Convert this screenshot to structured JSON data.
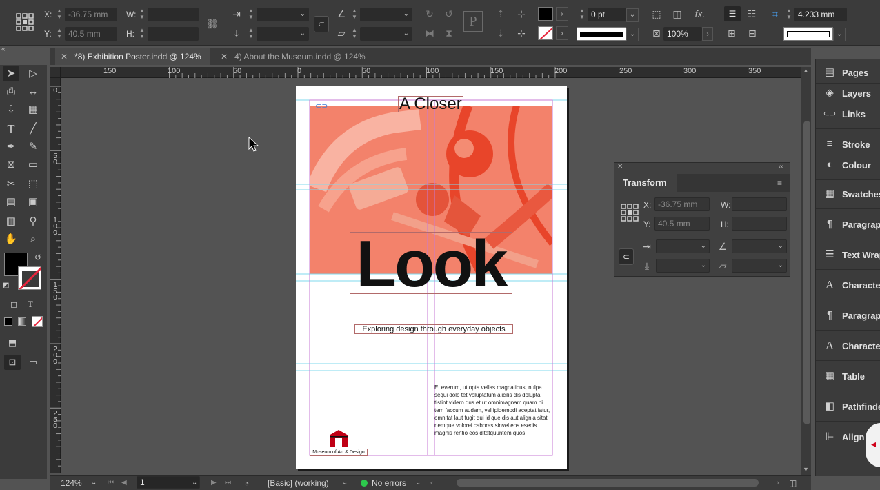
{
  "control_panel": {
    "x_label": "X:",
    "x_value": "-36.75 mm",
    "y_label": "Y:",
    "y_value": "40.5 mm",
    "w_label": "W:",
    "h_label": "H:",
    "stroke_weight": "0 pt",
    "opacity": "100%",
    "gutter_value": "4.233 mm",
    "fx_label": "fx."
  },
  "tabs": [
    {
      "label": "*8) Exhibition Poster.indd @ 124%",
      "active": true
    },
    {
      "label": "4) About the Museum.indd @ 124%",
      "active": false
    }
  ],
  "ruler": {
    "horizontal": [
      "150",
      "100",
      "50",
      "0",
      "50",
      "100",
      "150",
      "200",
      "250",
      "300",
      "350"
    ],
    "vertical": [
      [
        "0"
      ],
      [
        "5",
        "0"
      ],
      [
        "1",
        "0",
        "0"
      ],
      [
        "1",
        "5",
        "0"
      ],
      [
        "2",
        "0",
        "0"
      ],
      [
        "2",
        "5",
        "0"
      ]
    ]
  },
  "document": {
    "heading_small": "A Closer",
    "heading_large": "Look",
    "subtitle": "Exploring design through everyday objects",
    "body_text": "Et everum, ut opta vellas magnatibus, nulpa sequi dolo tet voluptatum alicilis dis dolupta tistint videro dus et ut omnimagnam quam ni tem faccum audam, vel ipidemodi aceptat iatur, omnitat laut fugit qui id que dis aut alignia sitati nemque volorei cabores sinvel eos esedis magnis rentio eos ditatquuntem quos.",
    "logo_caption": "Museum of Art & Design"
  },
  "transform_panel": {
    "title": "Transform",
    "x_label": "X:",
    "x_value": "-36.75 mm",
    "y_label": "Y:",
    "y_value": "40.5 mm",
    "w_label": "W:",
    "h_label": "H:"
  },
  "dock": {
    "items": [
      {
        "label": "Pages",
        "icon": "pages-icon",
        "glyph": "▤"
      },
      {
        "label": "Layers",
        "icon": "layers-icon",
        "glyph": "◈"
      },
      {
        "label": "Links",
        "icon": "links-icon",
        "glyph": "⊂⊃"
      },
      {
        "label": "Stroke",
        "icon": "stroke-icon",
        "glyph": "≡"
      },
      {
        "label": "Colour",
        "icon": "colour-icon",
        "glyph": "◐"
      },
      {
        "label": "Swatches",
        "icon": "swatches-icon",
        "glyph": "▦"
      },
      {
        "label": "Paragraph",
        "icon": "paragraph-icon",
        "glyph": "¶"
      },
      {
        "label": "Text Wrap",
        "icon": "text-wrap-icon",
        "glyph": "☰"
      },
      {
        "label": "Character",
        "icon": "character-icon",
        "glyph": "A"
      },
      {
        "label": "Paragraph",
        "icon": "paragraph-styles-icon",
        "glyph": "¶"
      },
      {
        "label": "Character",
        "icon": "character-styles-icon",
        "glyph": "A"
      },
      {
        "label": "Table",
        "icon": "table-icon",
        "glyph": "▦"
      },
      {
        "label": "Pathfinder",
        "icon": "pathfinder-icon",
        "glyph": "◧"
      },
      {
        "label": "Align",
        "icon": "align-icon",
        "glyph": "⊫"
      }
    ]
  },
  "status_bar": {
    "zoom": "124%",
    "page": "1",
    "profile": "[Basic] (working)",
    "preflight": "No errors"
  },
  "colors": {
    "accent_orange": "#f3826b",
    "photo_deep": "#e8452a",
    "guide_cyan": "#7fd8ee",
    "margin_magenta": "#c77ad6",
    "ok_green": "#2dc84d"
  }
}
